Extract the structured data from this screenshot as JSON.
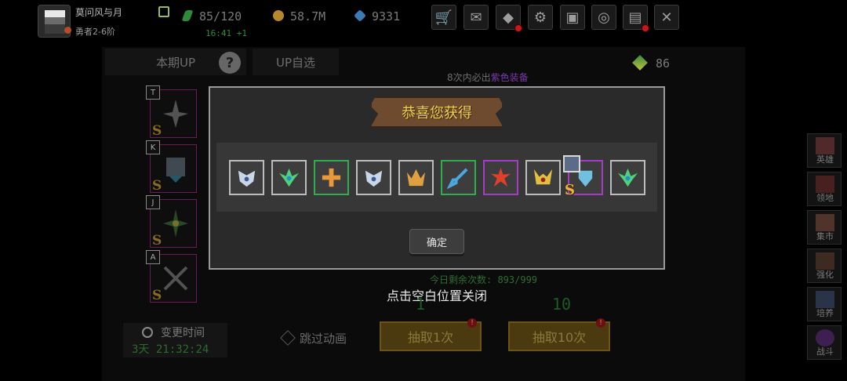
{
  "player": {
    "name": "莫问风与月",
    "rank": "勇者2-6阶"
  },
  "stats": {
    "energy": "85/120",
    "energy_timer": "16:41 +1",
    "gold": "58.7M",
    "diamonds": "9331"
  },
  "toolbar": {
    "icons": [
      "cart-icon",
      "mail-icon",
      "gamepad-icon",
      "gear-icon",
      "gift-icon",
      "wheel-icon",
      "scroll-icon",
      "swords-icon"
    ]
  },
  "tabs": {
    "current_up": "本期UP",
    "up_select": "UP自选"
  },
  "currency_right": "86",
  "guarantee": {
    "prefix": "8次内必出",
    "highlight": "紫色装备"
  },
  "cards": [
    {
      "tag": "T",
      "grade": "S"
    },
    {
      "tag": "K",
      "grade": "S"
    },
    {
      "tag": "J",
      "grade": "S"
    },
    {
      "tag": "A",
      "grade": "S"
    }
  ],
  "modal": {
    "title": "恭喜您获得",
    "confirm": "确定",
    "rewards": [
      {
        "rarity": "normal",
        "color": "#c9d6e8"
      },
      {
        "rarity": "normal",
        "color": "#4fd17a"
      },
      {
        "rarity": "green",
        "color": "#e89a3a"
      },
      {
        "rarity": "normal",
        "color": "#c9d6e8"
      },
      {
        "rarity": "normal",
        "color": "#e0a040"
      },
      {
        "rarity": "green",
        "color": "#4aa8e0"
      },
      {
        "rarity": "purple",
        "color": "#e0402a"
      },
      {
        "rarity": "normal",
        "color": "#e0c040"
      },
      {
        "rarity": "purple",
        "color": "#70c0e0",
        "grade": "S",
        "new": true
      },
      {
        "rarity": "normal",
        "color": "#4fd17a"
      }
    ]
  },
  "bottom": {
    "remaining": "今日剩余次数: 893/999",
    "close_hint": "点击空白位置关闭",
    "cost_single": "1",
    "cost_ten": "10",
    "change_time_label": "变更时间",
    "countdown_days": "3天",
    "countdown_time": "21:32:24",
    "skip_animation": "跳过动画",
    "draw_one": "抽取1次",
    "draw_ten": "抽取10次",
    "badge": "!"
  },
  "sidebar": [
    {
      "label": "英雄",
      "icon": "hero-icon"
    },
    {
      "label": "领地",
      "icon": "territory-icon"
    },
    {
      "label": "集市",
      "icon": "market-icon"
    },
    {
      "label": "强化",
      "icon": "enhance-icon"
    },
    {
      "label": "培养",
      "icon": "train-icon"
    },
    {
      "label": "战斗",
      "icon": "battle-icon"
    }
  ]
}
